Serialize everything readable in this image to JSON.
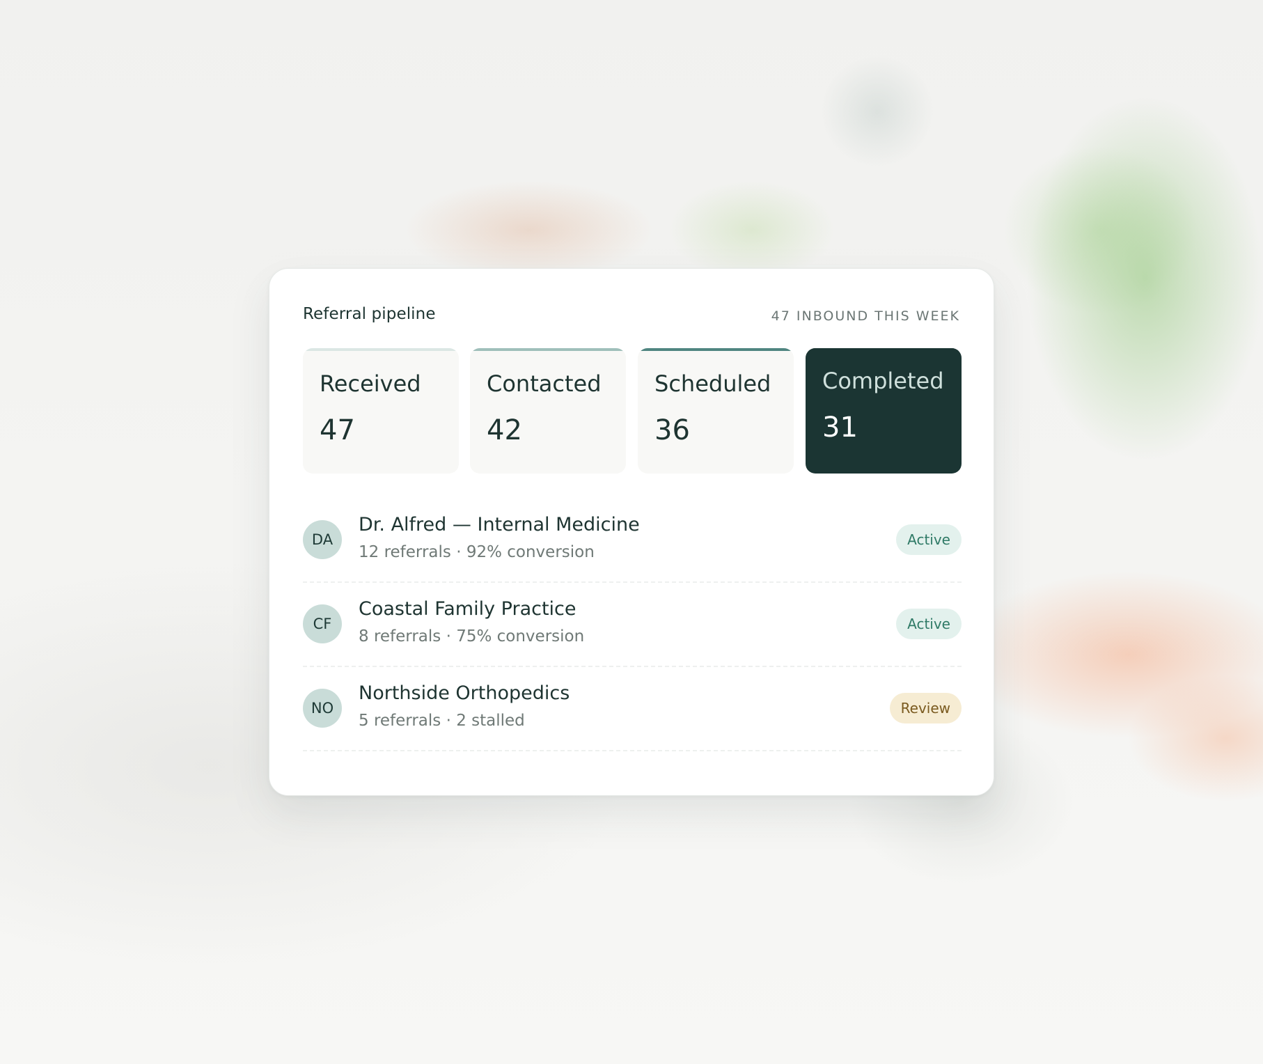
{
  "card": {
    "title": "Referral pipeline",
    "inbound_label": "47 INBOUND THIS WEEK"
  },
  "stages": [
    {
      "label": "Received",
      "value": "47",
      "bar_color": "#dbe7e4",
      "active": false
    },
    {
      "label": "Contacted",
      "value": "42",
      "bar_color": "#9fbfba",
      "active": false
    },
    {
      "label": "Scheduled",
      "value": "36",
      "bar_color": "#4f8580",
      "active": false
    },
    {
      "label": "Completed",
      "value": "31",
      "bar_color": "#1b3533",
      "active": true
    }
  ],
  "referrers": [
    {
      "initials": "DA",
      "name": "Dr. Alfred — Internal Medicine",
      "meta": "12 referrals · 92% conversion",
      "status": "Active",
      "status_bg": "#e3f1ed",
      "status_color": "#2f7a66"
    },
    {
      "initials": "CF",
      "name": "Coastal Family Practice",
      "meta": "8 referrals · 75% conversion",
      "status": "Active",
      "status_bg": "#e3f1ed",
      "status_color": "#2f7a66"
    },
    {
      "initials": "NO",
      "name": "Northside Orthopedics",
      "meta": "5 referrals · 2 stalled",
      "status": "Review",
      "status_bg": "#f6ecd3",
      "status_color": "#7a5a1f"
    }
  ],
  "colors": {
    "accent_dark": "#1b3533",
    "avatar_bg": "#c9dcd8"
  }
}
